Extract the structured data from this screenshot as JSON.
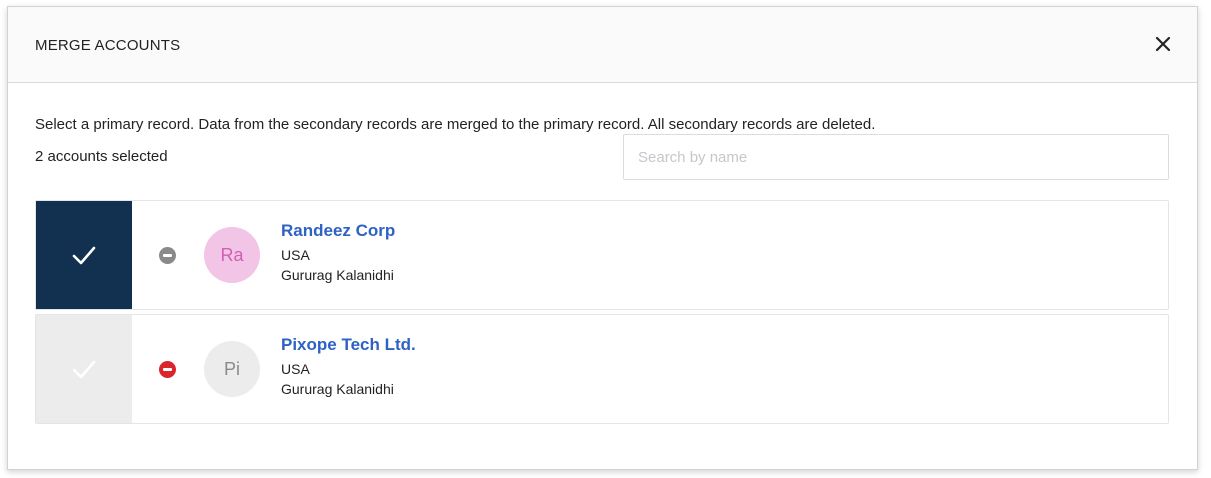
{
  "modal": {
    "title": "MERGE ACCOUNTS",
    "close_icon": "close-icon"
  },
  "description": "Select a primary record. Data from the secondary records are merged to the primary record. All secondary records are deleted.",
  "selected_count": "2 accounts selected",
  "search": {
    "placeholder": "Search by name",
    "value": ""
  },
  "accounts": [
    {
      "name": "Randeez Corp",
      "country": "USA",
      "owner": "Gururag Kalanidhi",
      "initials": "Ra",
      "is_primary": true,
      "check_color": "#ffffff",
      "check_bg": "#12304f",
      "remove_icon_color": "#8a8a8a",
      "avatar_bg": "#f2c4e6",
      "avatar_text_color": "#d25fb3"
    },
    {
      "name": "Pixope Tech Ltd.",
      "country": "USA",
      "owner": "Gururag Kalanidhi",
      "initials": "Pi",
      "is_primary": false,
      "check_color": "#ffffff",
      "check_bg": "#ececec",
      "remove_icon_color": "#d9262c",
      "avatar_bg": "#ececec",
      "avatar_text_color": "#8a8a8a"
    }
  ],
  "colors": {
    "link": "#2e62c4",
    "primary_dark": "#12304f"
  }
}
